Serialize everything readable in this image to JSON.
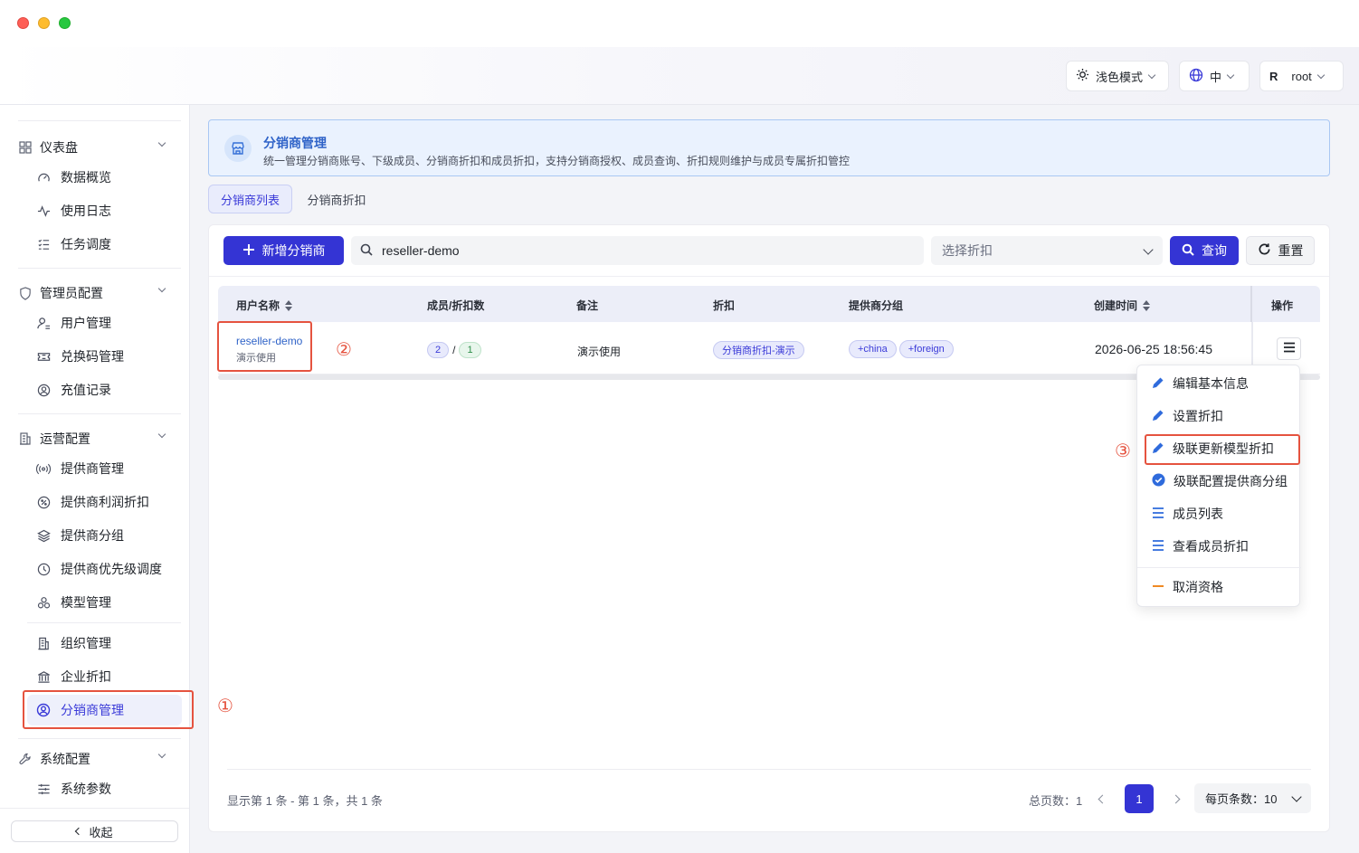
{
  "topbar": {
    "theme_label": "浅色模式",
    "lang_label": "中",
    "user_initial": "R",
    "user_name": "root"
  },
  "sidebar": {
    "groups": [
      {
        "label": "仪表盘",
        "icon": "grid-icon",
        "items": [
          {
            "label": "数据概览",
            "icon": "gauge-icon"
          },
          {
            "label": "使用日志",
            "icon": "activity-icon"
          },
          {
            "label": "任务调度",
            "icon": "checklist-icon"
          }
        ]
      },
      {
        "label": "管理员配置",
        "icon": "shield-icon",
        "items": [
          {
            "label": "用户管理",
            "icon": "user-manage-icon"
          },
          {
            "label": "兑换码管理",
            "icon": "ticket-icon"
          },
          {
            "label": "充值记录",
            "icon": "user-circle-icon"
          }
        ]
      },
      {
        "label": "运营配置",
        "icon": "building-icon",
        "items": [
          {
            "label": "提供商管理",
            "icon": "broadcast-icon"
          },
          {
            "label": "提供商利润折扣",
            "icon": "percent-icon"
          },
          {
            "label": "提供商分组",
            "icon": "layers-icon"
          },
          {
            "label": "提供商优先级调度",
            "icon": "clock-icon"
          },
          {
            "label": "模型管理",
            "icon": "models-icon"
          },
          {
            "label": "组织管理",
            "icon": "org-icon"
          },
          {
            "label": "企业折扣",
            "icon": "bank-icon"
          },
          {
            "label": "分销商管理",
            "icon": "reseller-icon"
          }
        ]
      },
      {
        "label": "系统配置",
        "icon": "wrench-icon",
        "items": [
          {
            "label": "系统参数",
            "icon": "sliders-icon"
          }
        ]
      }
    ],
    "collapse_label": "收起"
  },
  "annotations": [
    "①",
    "②",
    "③"
  ],
  "banner": {
    "title": "分销商管理",
    "description": "统一管理分销商账号、下级成员、分销商折扣和成员折扣，支持分销商授权、成员查询、折扣规则维护与成员专属折扣管控"
  },
  "tabs": [
    {
      "label": "分销商列表",
      "active": true
    },
    {
      "label": "分销商折扣",
      "active": false
    }
  ],
  "toolbar": {
    "add_label": "新增分销商",
    "search_value": "reseller-demo",
    "discount_placeholder": "选择折扣",
    "query_label": "查询",
    "reset_label": "重置"
  },
  "table": {
    "columns": [
      "用户名称",
      "成员/折扣数",
      "备注",
      "折扣",
      "提供商分组",
      "创建时间",
      "操作"
    ],
    "rows": [
      {
        "username": "reseller-demo",
        "sub": "演示使用",
        "members": "2",
        "slash": "/",
        "discounts": "1",
        "remark": "演示使用",
        "discount": "分销商折扣-演示",
        "groups": [
          "+china",
          "+foreign"
        ],
        "created": "2026-06-25 18:56:45"
      }
    ]
  },
  "action_menu": {
    "items": [
      {
        "label": "编辑基本信息",
        "icon": "pencil-icon"
      },
      {
        "label": "设置折扣",
        "icon": "pencil-icon"
      },
      {
        "label": "级联更新模型折扣",
        "icon": "pencil-icon"
      },
      {
        "label": "级联配置提供商分组",
        "icon": "check-circle-icon"
      },
      {
        "label": "成员列表",
        "icon": "list-icon"
      },
      {
        "label": "查看成员折扣",
        "icon": "list-icon"
      },
      {
        "label": "取消资格",
        "icon": "minus-icon"
      }
    ]
  },
  "pagination": {
    "summary": "显示第 1 条 - 第 1 条，共 1 条",
    "total_pages_label": "总页数：",
    "total_pages": "1",
    "current_page": "1",
    "page_size_label": "每页条数：",
    "page_size": "10"
  },
  "colors": {
    "accent": "#3434d4",
    "annotation": "#e5533f",
    "link": "#2f63c8"
  }
}
